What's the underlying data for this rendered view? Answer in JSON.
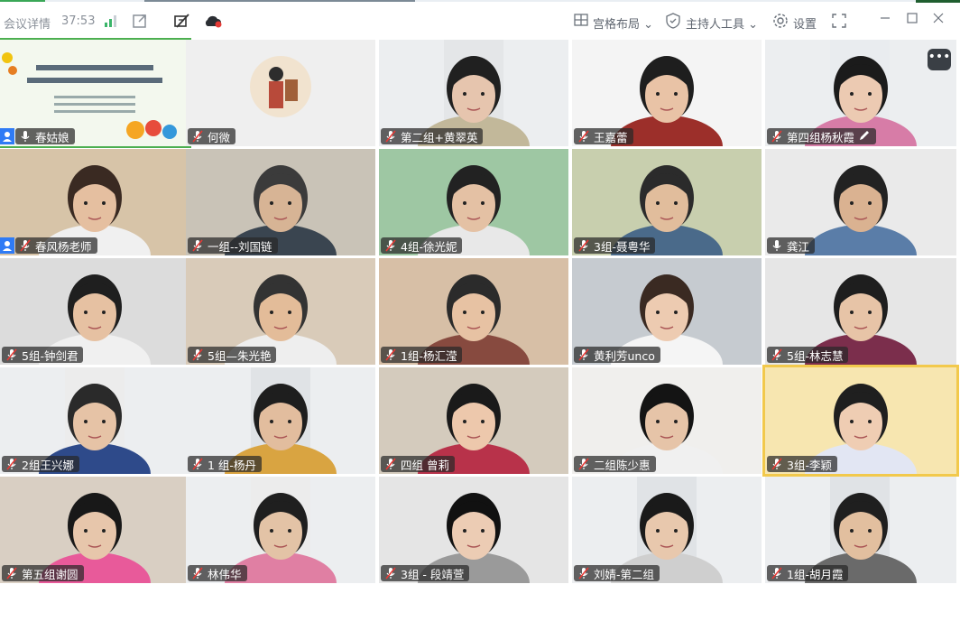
{
  "titlebar": {
    "meeting_details": "会议详情",
    "duration": "37:53",
    "layout_label": "宫格布局",
    "host_tools_label": "主持人工具",
    "settings_label": "设置"
  },
  "colors": {
    "accent_blue": "#2f7bf5",
    "nameplate_bg": "#3a3a3a",
    "active_speaker_border": "#4caf50"
  },
  "participants": [
    {
      "name": "春姑娘",
      "mic": "on",
      "host": true
    },
    {
      "name": "何微",
      "mic": "muted"
    },
    {
      "name": "第二组+黄翠英",
      "mic": "muted"
    },
    {
      "name": "王嘉蕾",
      "mic": "muted"
    },
    {
      "name": "第四组杨秋霞",
      "mic": "muted"
    },
    {
      "name": "春风杨老师",
      "mic": "muted",
      "host": true
    },
    {
      "name": "一组--刘国链",
      "mic": "muted"
    },
    {
      "name": "4组-徐光妮",
      "mic": "muted"
    },
    {
      "name": "3组-聂粤华",
      "mic": "muted"
    },
    {
      "name": "龚江",
      "mic": "on"
    },
    {
      "name": "5组-钟剑君",
      "mic": "muted"
    },
    {
      "name": "5组—朱光艳",
      "mic": "muted"
    },
    {
      "name": "1组-杨汇滢",
      "mic": "muted"
    },
    {
      "name": "黄利芳unco",
      "mic": "muted"
    },
    {
      "name": "5组-林志慧",
      "mic": "muted"
    },
    {
      "name": "2组王兴娜",
      "mic": "muted"
    },
    {
      "name": "1 组-杨丹",
      "mic": "muted"
    },
    {
      "name": "四组 曾莉",
      "mic": "muted"
    },
    {
      "name": "二组陈少惠",
      "mic": "muted"
    },
    {
      "name": "3组-李颖",
      "mic": "muted"
    },
    {
      "name": "第五组谢圆",
      "mic": "muted"
    },
    {
      "name": "林伟华",
      "mic": "muted"
    },
    {
      "name": "3组 - 段靖萱",
      "mic": "muted"
    },
    {
      "name": "刘婧-第二组",
      "mic": "muted"
    },
    {
      "name": "1组-胡月霞",
      "mic": "muted"
    }
  ]
}
